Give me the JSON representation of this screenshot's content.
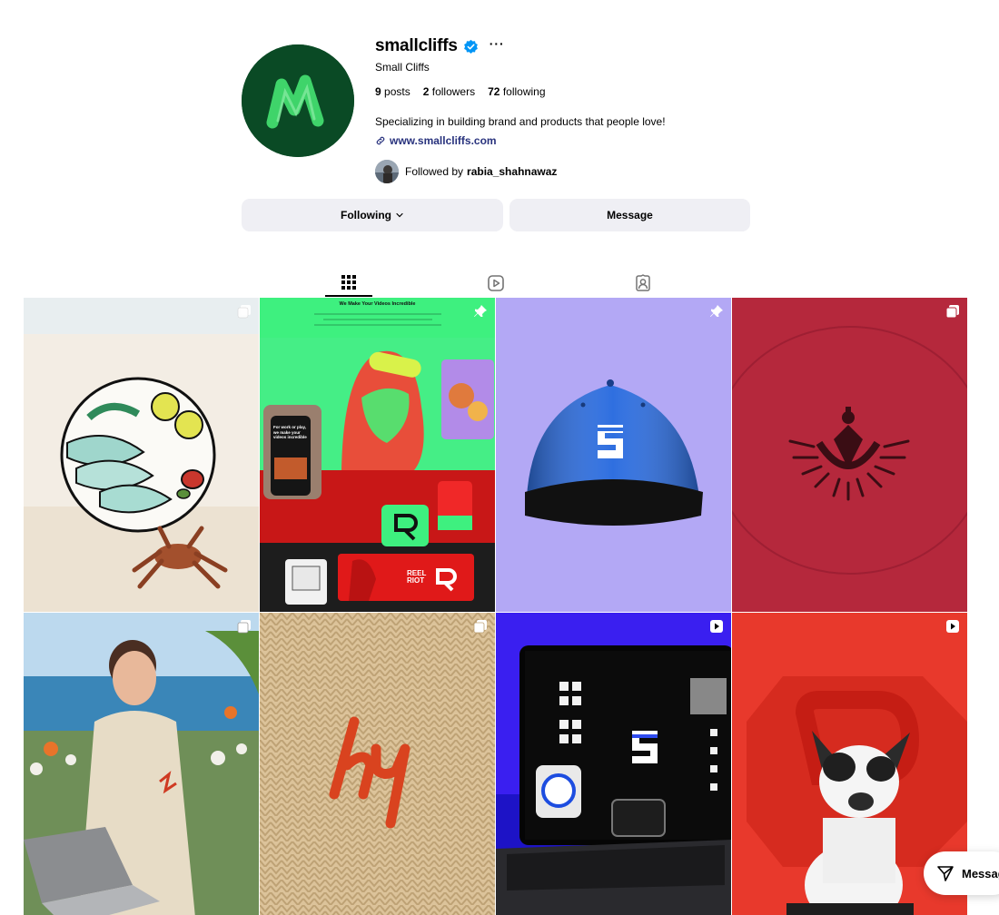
{
  "profile": {
    "username": "smallcliffs",
    "full_name": "Small Cliffs",
    "more_label": "···",
    "stats": {
      "posts_count": "9",
      "posts_label": "posts",
      "followers_count": "2",
      "followers_label": "followers",
      "following_count": "72",
      "following_label": "following"
    },
    "bio": "Specializing in building brand and products that people love!",
    "website": "www.smallcliffs.com",
    "followed_by_prefix": "Followed by",
    "followed_by_user": "rabia_shahnawaz"
  },
  "actions": {
    "following_label": "Following",
    "message_label": "Message"
  },
  "tabs": [
    {
      "name": "posts",
      "icon": "grid-icon",
      "active": true
    },
    {
      "name": "reels",
      "icon": "reels-icon",
      "active": false
    },
    {
      "name": "tagged",
      "icon": "tagged-icon",
      "active": false
    }
  ],
  "posts": [
    {
      "subject": "fish-plate-and-crab-on-beach",
      "badge": "carousel-icon"
    },
    {
      "subject": "reel-riot-brand-collage",
      "badge": "pin-icon",
      "headline": "We Make Your Videos Incredible",
      "phone_text": "For work or play, we make your videos incredible",
      "card_label": "REEL RIOT"
    },
    {
      "subject": "blue-cap-on-lavender",
      "badge": "pin-icon"
    },
    {
      "subject": "anchor-emblem-on-red",
      "badge": "carousel-icon"
    },
    {
      "subject": "man-in-sweater-with-laptop",
      "badge": "carousel-icon"
    },
    {
      "subject": "embroidered-logo-on-knit",
      "badge": "carousel-icon"
    },
    {
      "subject": "laptop-brand-screen",
      "badge": "reel-icon"
    },
    {
      "subject": "french-bulldog-on-red",
      "badge": "reel-icon"
    }
  ],
  "floating_message": {
    "label": "Messag"
  },
  "colors": {
    "verified_blue": "#0095f6",
    "link_color": "#28327d",
    "button_bg": "#efeff4",
    "avatar_green": "#0a4a25"
  }
}
